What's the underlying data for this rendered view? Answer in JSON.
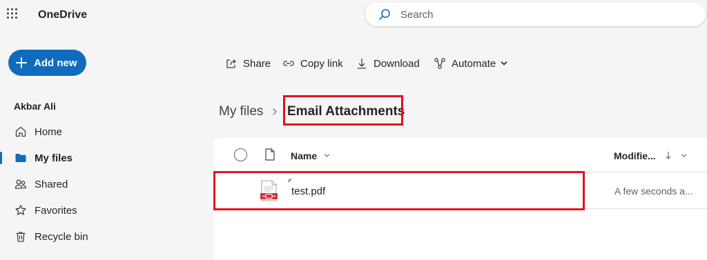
{
  "header": {
    "app_name": "OneDrive",
    "search_placeholder": "Search"
  },
  "sidebar": {
    "add_new_label": "Add new",
    "user_name": "Akbar Ali",
    "items": [
      {
        "label": "Home",
        "icon": "home-icon"
      },
      {
        "label": "My files",
        "icon": "folder-icon",
        "active": true
      },
      {
        "label": "Shared",
        "icon": "people-icon"
      },
      {
        "label": "Favorites",
        "icon": "star-icon"
      },
      {
        "label": "Recycle bin",
        "icon": "trash-icon"
      }
    ]
  },
  "toolbar": {
    "share_label": "Share",
    "copy_link_label": "Copy link",
    "download_label": "Download",
    "automate_label": "Automate"
  },
  "breadcrumb": {
    "root": "My files",
    "current": "Email Attachments"
  },
  "file_list": {
    "columns": {
      "name": "Name",
      "modified": "Modifie..."
    },
    "rows": [
      {
        "name": "test.pdf",
        "modified": "A few seconds a...",
        "type": "pdf"
      }
    ]
  },
  "colors": {
    "accent": "#0f6cbd",
    "highlight": "#e3101e",
    "pdf": "#d13438"
  }
}
